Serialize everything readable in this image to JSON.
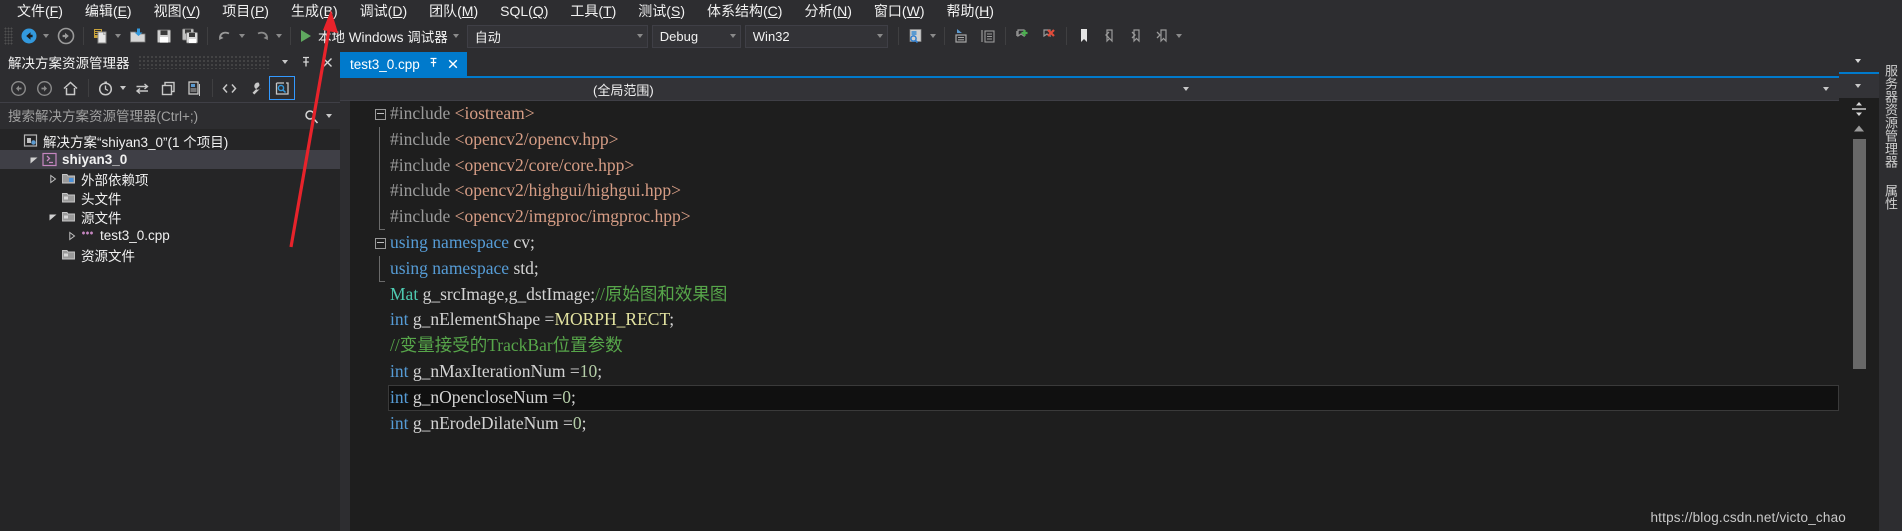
{
  "menu": {
    "items": [
      {
        "label": "文件(F)",
        "accel": "F"
      },
      {
        "label": "编辑(E)",
        "accel": "E"
      },
      {
        "label": "视图(V)",
        "accel": "V"
      },
      {
        "label": "项目(P)",
        "accel": "P"
      },
      {
        "label": "生成(B)",
        "accel": "B"
      },
      {
        "label": "调试(D)",
        "accel": "D"
      },
      {
        "label": "团队(M)",
        "accel": "M"
      },
      {
        "label": "SQL(Q)",
        "accel": "Q"
      },
      {
        "label": "工具(T)",
        "accel": "T"
      },
      {
        "label": "测试(S)",
        "accel": "S"
      },
      {
        "label": "体系结构(C)",
        "accel": "C"
      },
      {
        "label": "分析(N)",
        "accel": "N"
      },
      {
        "label": "窗口(W)",
        "accel": "W"
      },
      {
        "label": "帮助(H)",
        "accel": "H"
      }
    ]
  },
  "toolbar": {
    "nav_back": "后退",
    "nav_forward": "前进",
    "new_item": "新建项",
    "open_file": "打开文件",
    "save": "保存",
    "save_all": "全部保存",
    "undo": "撤消",
    "redo": "恢复",
    "start_debug_label": "本地 Windows 调试器",
    "config_platform_combo": "自动",
    "config_combo": "Debug",
    "platform_combo": "Win32",
    "find_in_files": "在文件中查找",
    "comment": "注释选定行",
    "uncomment": "取消注释选定行",
    "add_bookmark": "添加书签",
    "remove_bookmark": "删除书签",
    "prev_bookmark": "上一书签",
    "next_bookmark": "下一书签",
    "bookmark_window": "书签窗口"
  },
  "solution_explorer": {
    "title": "解决方案资源管理器",
    "search_placeholder": "搜索解决方案资源管理器(Ctrl+;)",
    "toolbar": {
      "back": "后退",
      "forward": "前进",
      "home": "主页",
      "pending_changes": "挂起的更改筛选器",
      "sync": "与活动文档同步",
      "refresh": "刷新",
      "show_all_files": "显示所有文件",
      "code_view": "查看代码",
      "properties": "属性",
      "preview_selected": "预览选定的项"
    },
    "tree": [
      {
        "label": "解决方案“shiyan3_0”(1 个项目)",
        "indent": 0,
        "twisty": "none",
        "icon": "solution-icon",
        "selected": false,
        "bold": false
      },
      {
        "label": "shiyan3_0",
        "indent": 1,
        "twisty": "expanded",
        "icon": "project-icon",
        "selected": true,
        "bold": true
      },
      {
        "label": "外部依赖项",
        "indent": 2,
        "twisty": "collapsed",
        "icon": "folder-deps-icon",
        "selected": false,
        "bold": false
      },
      {
        "label": "头文件",
        "indent": 2,
        "twisty": "none",
        "icon": "folder-icon",
        "selected": false,
        "bold": false
      },
      {
        "label": "源文件",
        "indent": 2,
        "twisty": "expanded",
        "icon": "folder-icon",
        "selected": false,
        "bold": false
      },
      {
        "label": "test3_0.cpp",
        "indent": 3,
        "twisty": "collapsed",
        "icon": "cpp-file-icon",
        "selected": false,
        "bold": false
      },
      {
        "label": "资源文件",
        "indent": 2,
        "twisty": "none",
        "icon": "folder-icon",
        "selected": false,
        "bold": false
      }
    ],
    "panel_buttons": {
      "dropdown": "窗口位置",
      "pin": "自动隐藏",
      "close": "关闭"
    }
  },
  "editor": {
    "tab": {
      "name": "test3_0.cpp",
      "pin": "固定",
      "close": "关闭"
    },
    "scope": {
      "left": "",
      "value": "(全局范围)"
    },
    "colors": {
      "tab_active": "#007acc",
      "editor_bg": "#1e1e1e",
      "keyword": "#569cd6",
      "preprocessor": "#9b9b9b",
      "include_path": "#d69d85",
      "type": "#4ec9b0",
      "comment": "#57a64a",
      "macro": "#e2e2a0",
      "number": "#b5cea8"
    },
    "lines": [
      {
        "fold": "start",
        "cur": false,
        "tokens": [
          {
            "t": "#include ",
            "c": "pp"
          },
          {
            "t": "<iostream>",
            "c": "inc"
          }
        ]
      },
      {
        "fold": "mid",
        "cur": false,
        "tokens": [
          {
            "t": "#include ",
            "c": "pp"
          },
          {
            "t": "<opencv2/opencv.hpp>",
            "c": "inc"
          }
        ]
      },
      {
        "fold": "mid",
        "cur": false,
        "tokens": [
          {
            "t": "#include ",
            "c": "pp"
          },
          {
            "t": "<opencv2/core/core.hpp>",
            "c": "inc"
          }
        ]
      },
      {
        "fold": "mid",
        "cur": false,
        "tokens": [
          {
            "t": "#include ",
            "c": "pp"
          },
          {
            "t": "<opencv2/highgui/highgui.hpp>",
            "c": "inc"
          }
        ]
      },
      {
        "fold": "end",
        "cur": false,
        "tokens": [
          {
            "t": "#include ",
            "c": "pp"
          },
          {
            "t": "<opencv2/imgproc/imgproc.hpp>",
            "c": "inc"
          }
        ]
      },
      {
        "fold": "start",
        "cur": false,
        "tokens": [
          {
            "t": "using namespace",
            "c": "kw"
          },
          {
            "t": " cv;",
            "c": "pl"
          }
        ]
      },
      {
        "fold": "end",
        "cur": false,
        "tokens": [
          {
            "t": "using namespace",
            "c": "kw"
          },
          {
            "t": " std;",
            "c": "pl"
          }
        ]
      },
      {
        "fold": "none",
        "cur": false,
        "tokens": [
          {
            "t": "Mat",
            "c": "type"
          },
          {
            "t": " g_srcImage,g_dstImage;",
            "c": "pl"
          },
          {
            "t": "//原始图和效果图",
            "c": "cmt"
          }
        ]
      },
      {
        "fold": "none",
        "cur": false,
        "tokens": [
          {
            "t": "int",
            "c": "kw"
          },
          {
            "t": " g_nElementShape =",
            "c": "pl"
          },
          {
            "t": "MORPH_RECT",
            "c": "macro"
          },
          {
            "t": ";",
            "c": "pl"
          }
        ]
      },
      {
        "fold": "none",
        "cur": false,
        "tokens": [
          {
            "t": "//变量接受的TrackBar位置参数",
            "c": "cmt"
          }
        ]
      },
      {
        "fold": "none",
        "cur": false,
        "tokens": [
          {
            "t": "int",
            "c": "kw"
          },
          {
            "t": " g_nMaxIterationNum =",
            "c": "pl"
          },
          {
            "t": "10",
            "c": "num"
          },
          {
            "t": ";",
            "c": "pl"
          }
        ]
      },
      {
        "fold": "none",
        "cur": true,
        "tokens": [
          {
            "t": "int",
            "c": "kw"
          },
          {
            "t": " g_nOpencloseNum =",
            "c": "pl"
          },
          {
            "t": "0",
            "c": "num"
          },
          {
            "t": ";",
            "c": "pl"
          }
        ]
      },
      {
        "fold": "none",
        "cur": false,
        "tokens": [
          {
            "t": "int",
            "c": "kw"
          },
          {
            "t": " g_nErodeDilateNum =",
            "c": "pl"
          },
          {
            "t": "0",
            "c": "num"
          },
          {
            "t": ";",
            "c": "pl"
          }
        ]
      }
    ]
  },
  "right_rail": {
    "tabs": [
      "服务器资源管理器",
      "属性"
    ]
  },
  "watermark": "https://blog.csdn.net/victo_chao"
}
